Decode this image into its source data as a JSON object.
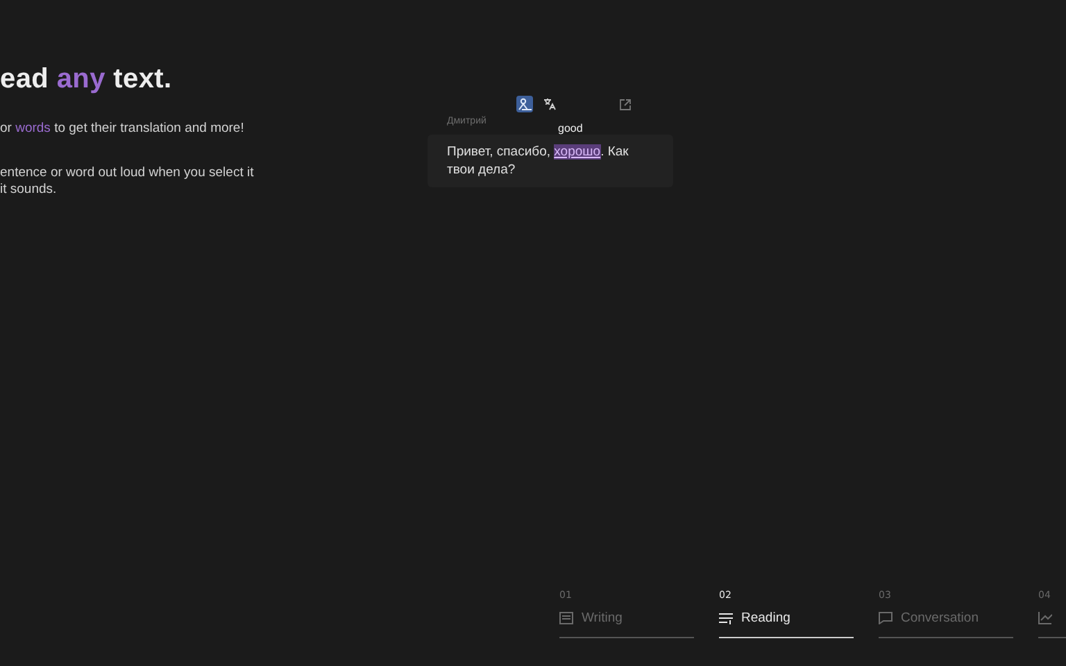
{
  "intro": {
    "heading_before": "ead ",
    "heading_accent": "any",
    "heading_after": " text.",
    "paragraphs": [
      "or *words* to get their translation and more!",
      "entence or word out loud when you select it\nit sounds."
    ]
  },
  "chat": {
    "toolbar": [
      {
        "kind": "reader",
        "selected": true
      },
      {
        "kind": "translate",
        "selected": false
      },
      {
        "kind": "external",
        "selected": false
      }
    ],
    "sender": "Дмитрий",
    "tooltip": "good",
    "before": "Привет, спасибо, ",
    "highlight": "хорошо",
    "after": ". Как твои дела?"
  },
  "tabs": [
    {
      "number": "01",
      "label": "Writing",
      "kind": "writing",
      "selected": false
    },
    {
      "number": "02",
      "label": "Reading",
      "kind": "reading",
      "selected": true
    },
    {
      "number": "03",
      "label": "Conversation",
      "kind": "conversation",
      "selected": false
    },
    {
      "number": "04",
      "kind": "progress",
      "selected": false
    }
  ]
}
